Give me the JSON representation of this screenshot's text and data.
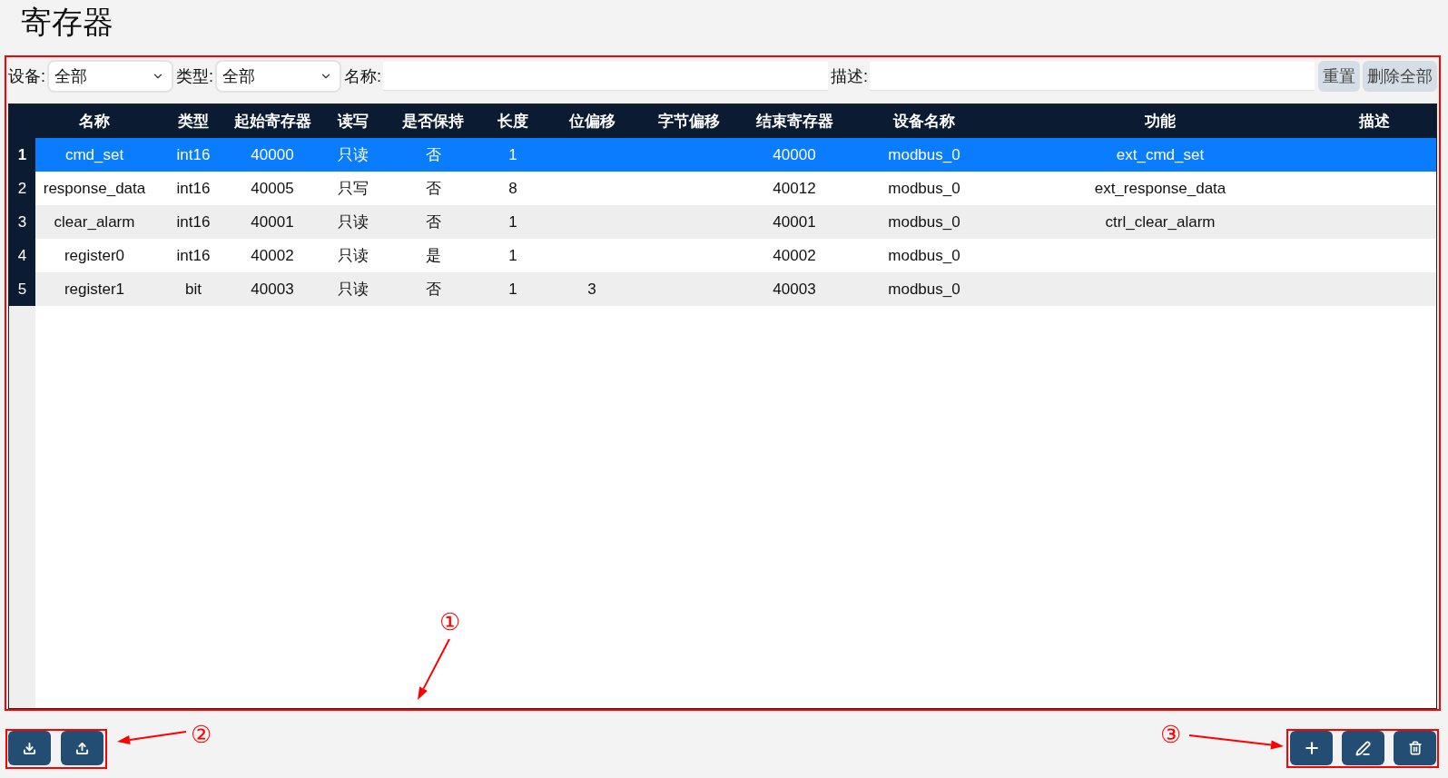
{
  "page_title": "寄存器",
  "filters": [
    {
      "kind": "select",
      "label": "设备:",
      "value": "全部"
    },
    {
      "kind": "select",
      "label": "类型:",
      "value": "全部"
    },
    {
      "kind": "input",
      "label": "名称:"
    },
    {
      "kind": "input",
      "label": "描述:"
    }
  ],
  "filter_buttons": [
    "重置",
    "删除全部"
  ],
  "table": {
    "columns": [
      "名称",
      "类型",
      "起始寄存器",
      "读写",
      "是否保持",
      "长度",
      "位偏移",
      "字节偏移",
      "结束寄存器",
      "设备名称",
      "功能",
      "描述"
    ],
    "rows": [
      {
        "index": "1",
        "selected": true,
        "cells": [
          "cmd_set",
          "int16",
          "40000",
          "只读",
          "否",
          "1",
          null,
          null,
          "40000",
          "modbus_0",
          "ext_cmd_set",
          null
        ]
      },
      {
        "index": "2",
        "selected": false,
        "cells": [
          "response_data",
          "int16",
          "40005",
          "只写",
          "否",
          "8",
          null,
          null,
          "40012",
          "modbus_0",
          "ext_response_data",
          null
        ]
      },
      {
        "index": "3",
        "selected": false,
        "cells": [
          "clear_alarm",
          "int16",
          "40001",
          "只读",
          "否",
          "1",
          null,
          null,
          "40001",
          "modbus_0",
          "ctrl_clear_alarm",
          null
        ]
      },
      {
        "index": "4",
        "selected": false,
        "cells": [
          "register0",
          "int16",
          "40002",
          "只读",
          "是",
          "1",
          null,
          null,
          "40002",
          "modbus_0",
          null,
          null
        ]
      },
      {
        "index": "5",
        "selected": false,
        "cells": [
          "register1",
          "bit",
          "40003",
          "只读",
          "否",
          "1",
          "3",
          null,
          "40003",
          "modbus_0",
          null,
          null
        ]
      }
    ]
  },
  "left_actions": [
    {
      "kind": "download"
    },
    {
      "kind": "upload"
    }
  ],
  "right_actions": [
    {
      "kind": "add"
    },
    {
      "kind": "edit"
    },
    {
      "kind": "delete"
    }
  ],
  "annotations": [
    {
      "label": "①"
    },
    {
      "label": "②"
    },
    {
      "label": "③"
    }
  ]
}
